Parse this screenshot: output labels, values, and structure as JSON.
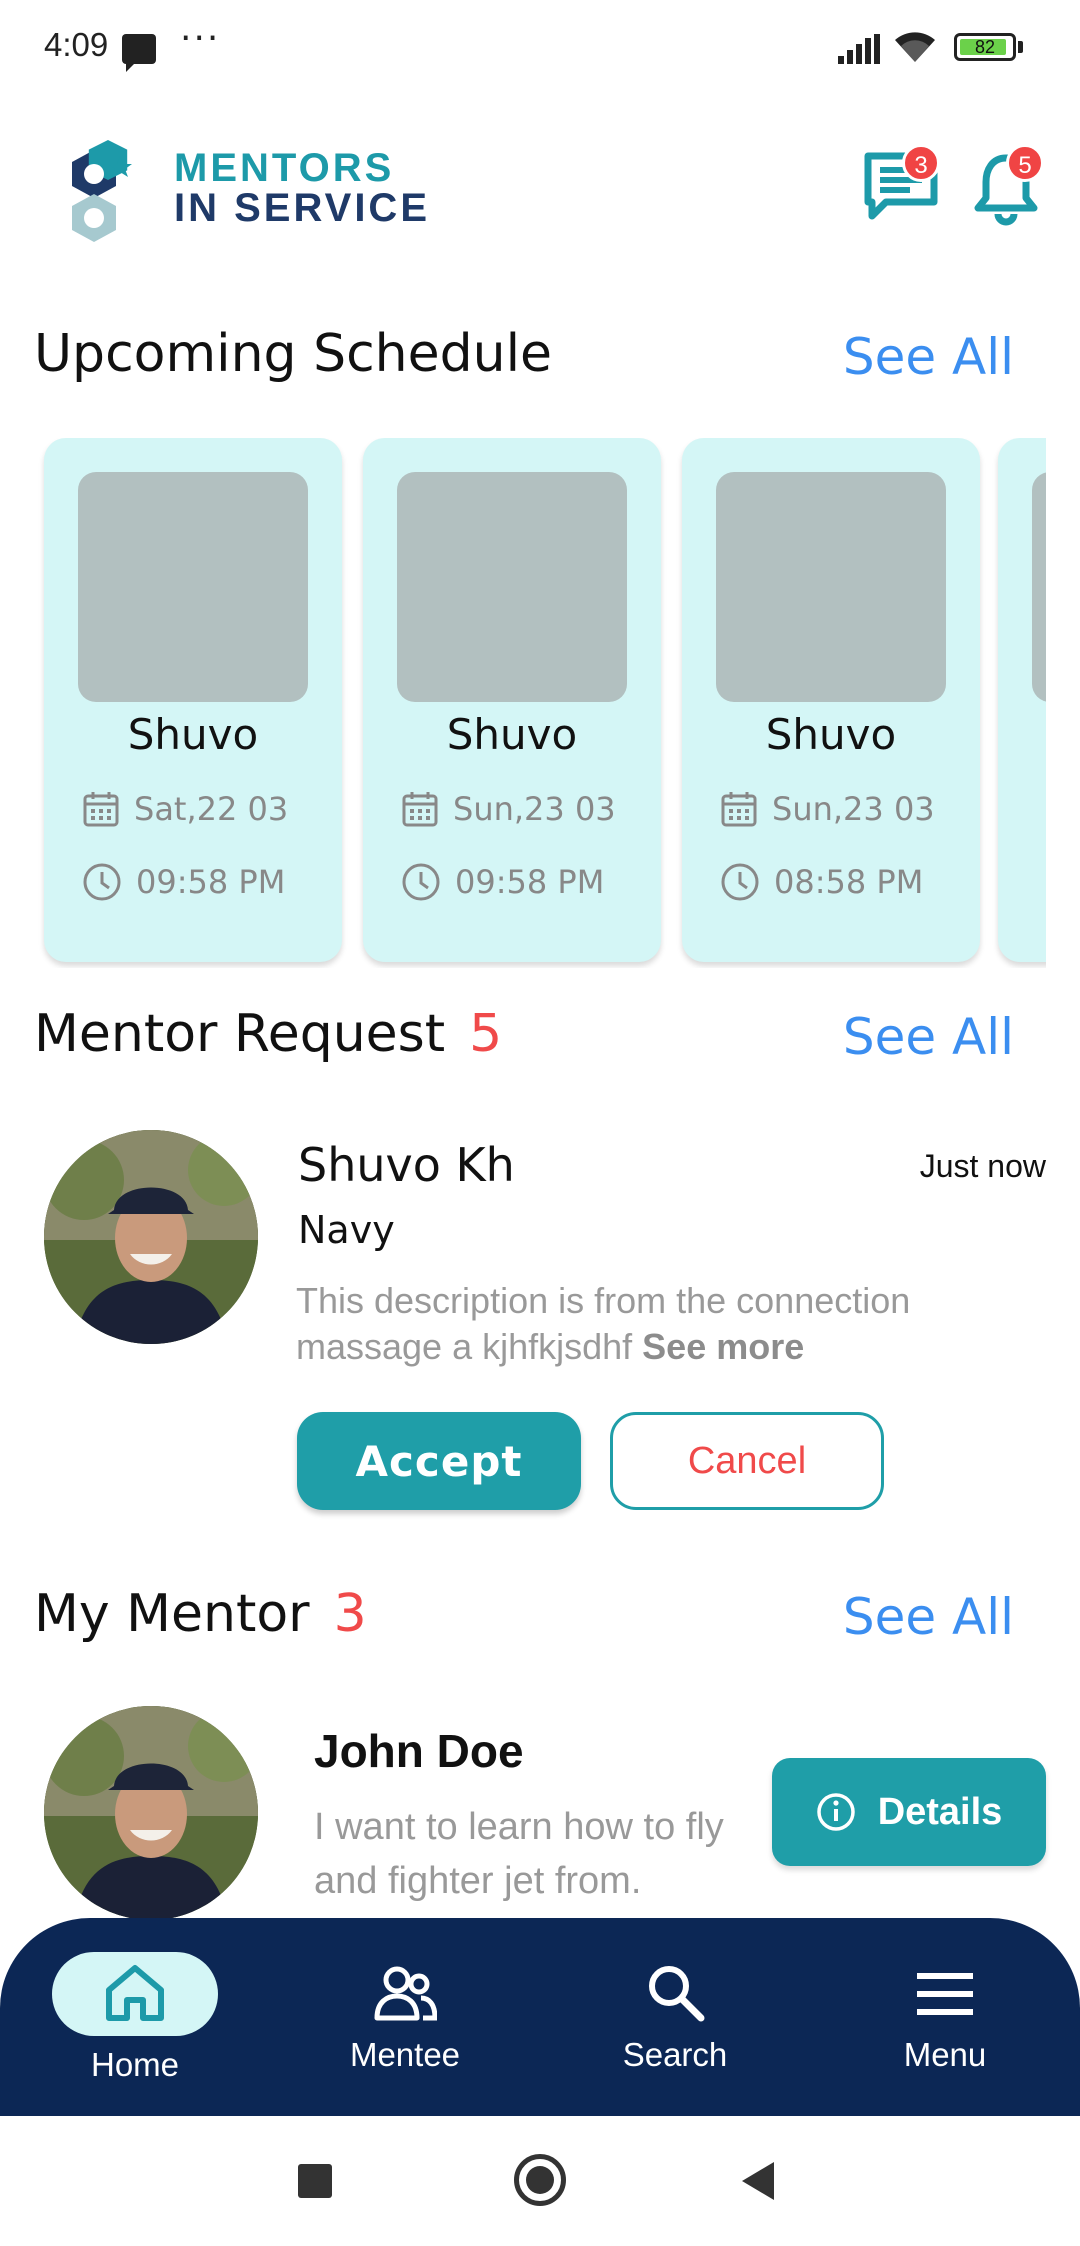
{
  "status_bar": {
    "time": "4:09",
    "dots": "···",
    "battery": "82"
  },
  "header": {
    "logo_line1": "MENTORS",
    "logo_line2": "IN SERVICE",
    "messages_badge": "3",
    "notifications_badge": "5"
  },
  "upcoming": {
    "title": "Upcoming Schedule",
    "see_all": "See All",
    "cards": [
      {
        "name": "Shuvo",
        "date": "Sat,22 03",
        "time": "09:58 PM"
      },
      {
        "name": "Shuvo",
        "date": "Sun,23 03",
        "time": "09:58 PM"
      },
      {
        "name": "Shuvo",
        "date": "Sun,23 03",
        "time": "08:58 PM"
      }
    ]
  },
  "mentor_request": {
    "title": "Mentor Request",
    "count": "5",
    "see_all": "See All",
    "item": {
      "name": "Shuvo Kh",
      "time": "Just now",
      "branch": "Navy",
      "description": " This description is from the connection massage a kjhfkjsdhf ",
      "see_more": "See more",
      "accept_label": "Accept",
      "cancel_label": "Cancel"
    }
  },
  "my_mentor": {
    "title": "My Mentor",
    "count": "3",
    "see_all": "See All",
    "item": {
      "name": "John Doe",
      "description": "I want to learn how to fly and fighter jet from.",
      "details_label": "Details"
    }
  },
  "bottom_nav": {
    "items": [
      {
        "label": "Home",
        "icon": "home-icon"
      },
      {
        "label": "Mentee",
        "icon": "mentee-icon"
      },
      {
        "label": "Search",
        "icon": "search-icon"
      },
      {
        "label": "Menu",
        "icon": "menu-icon"
      }
    ]
  },
  "colors": {
    "teal": "#1f9ea8",
    "navy": "#0c2755",
    "card_bg": "#d4f6f6",
    "link_blue": "#3b8ef0",
    "alert_red": "#f04a4a"
  }
}
